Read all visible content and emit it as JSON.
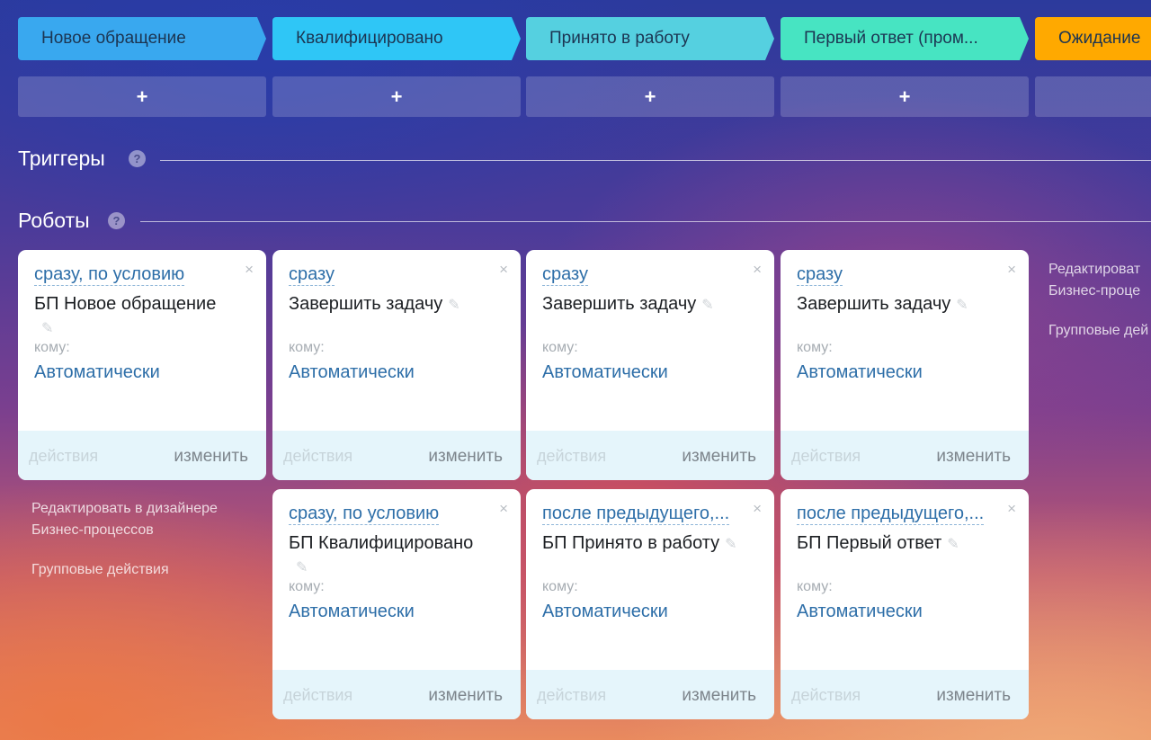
{
  "stages": [
    {
      "label": "Новое обращение",
      "color": "#39a8ef"
    },
    {
      "label": "Квалифицировано",
      "color": "#2fc6f6"
    },
    {
      "label": "Принято в работу",
      "color": "#55d0e0"
    },
    {
      "label": "Первый ответ (пром...",
      "color": "#47e4c2"
    },
    {
      "label": "Ожидание",
      "color": "#ffa900"
    }
  ],
  "add_button_label": "+",
  "triggers": {
    "title": "Триггеры",
    "help": "?"
  },
  "robots": {
    "title": "Роботы",
    "help": "?"
  },
  "cards": [
    {
      "when": "сразу, по условию",
      "action": "БП Новое обращение",
      "whom_label": "кому:",
      "assignee": "Автоматически",
      "actions_label": "действия",
      "edit_label": "изменить",
      "close": "×"
    },
    {
      "when": "сразу",
      "action": "Завершить задачу",
      "whom_label": "кому:",
      "assignee": "Автоматически",
      "actions_label": "действия",
      "edit_label": "изменить",
      "close": "×"
    },
    {
      "when": "сразу",
      "action": "Завершить задачу",
      "whom_label": "кому:",
      "assignee": "Автоматически",
      "actions_label": "действия",
      "edit_label": "изменить",
      "close": "×"
    },
    {
      "when": "сразу",
      "action": "Завершить задачу",
      "whom_label": "кому:",
      "assignee": "Автоматически",
      "actions_label": "действия",
      "edit_label": "изменить",
      "close": "×"
    },
    {
      "when": "сразу, по условию",
      "action": "БП Квалифицировано",
      "whom_label": "кому:",
      "assignee": "Автоматически",
      "actions_label": "действия",
      "edit_label": "изменить",
      "close": "×"
    },
    {
      "when": "после предыдущего,...",
      "action": "БП Принято в работу",
      "whom_label": "кому:",
      "assignee": "Автоматически",
      "actions_label": "действия",
      "edit_label": "изменить",
      "close": "×"
    },
    {
      "when": "после предыдущего,...",
      "action": "БП Первый ответ",
      "whom_label": "кому:",
      "assignee": "Автоматически",
      "actions_label": "действия",
      "edit_label": "изменить",
      "close": "×"
    }
  ],
  "side_links": {
    "designer_line1": "Редактировать в дизайнере",
    "designer_line2": "Бизнес-процессов",
    "group_actions": "Групповые действия",
    "designer_line1_cut": "Редактироват",
    "designer_line2_cut": "Бизнес-проце",
    "group_actions_cut": "Групповые дей"
  },
  "pencil_icon": "✎"
}
